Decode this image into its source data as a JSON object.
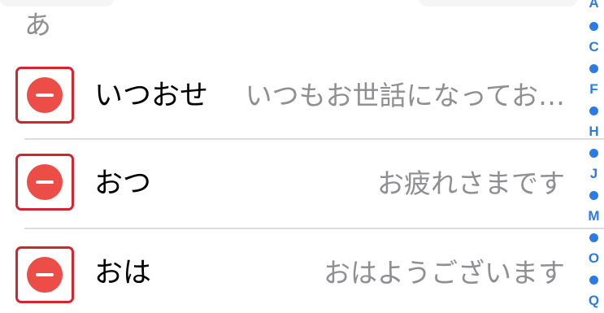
{
  "section": {
    "header": "あ"
  },
  "rows": [
    {
      "title": "いつおせ",
      "value": "いつもお世話になってお…"
    },
    {
      "title": "おつ",
      "value": "お疲れさまです"
    },
    {
      "title": "おは",
      "value": "おはようございます"
    }
  ],
  "index": [
    "A",
    "•",
    "C",
    "•",
    "F",
    "•",
    "H",
    "•",
    "J",
    "•",
    "M",
    "•",
    "O",
    "•",
    "Q"
  ],
  "colors": {
    "delete": "#ec4d47",
    "highlight_border": "#d1252f",
    "index": "#2c7be5",
    "secondary_text": "#8e8e93"
  }
}
